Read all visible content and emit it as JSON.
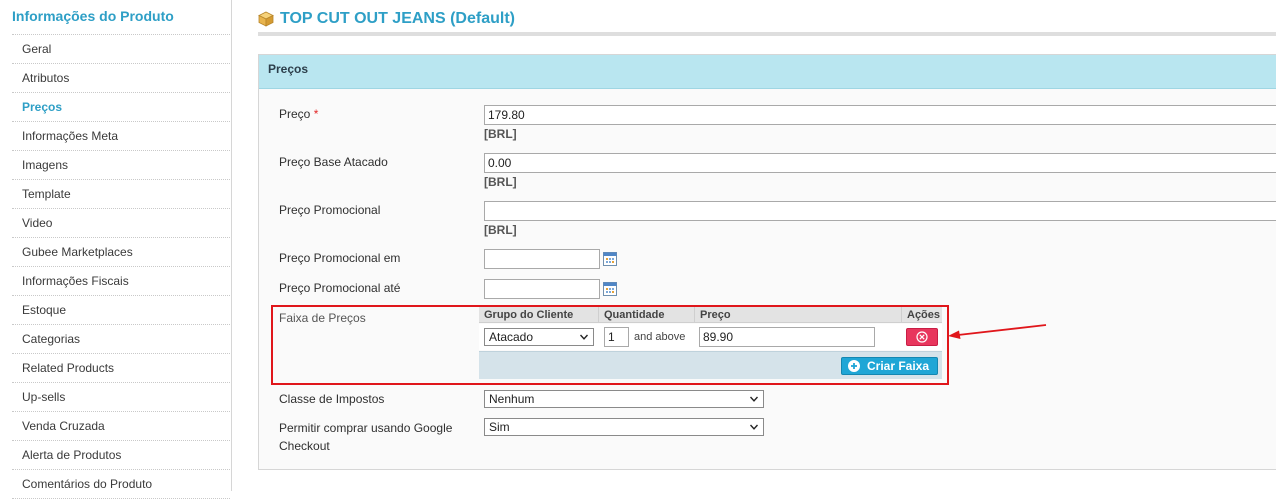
{
  "sidebar": {
    "title": "Informações do Produto",
    "items": [
      {
        "label": "Geral"
      },
      {
        "label": "Atributos"
      },
      {
        "label": "Preços",
        "active": true
      },
      {
        "label": "Informações Meta"
      },
      {
        "label": "Imagens"
      },
      {
        "label": "Template"
      },
      {
        "label": "Video"
      },
      {
        "label": "Gubee Marketplaces"
      },
      {
        "label": "Informações Fiscais"
      },
      {
        "label": "Estoque"
      },
      {
        "label": "Categorias"
      },
      {
        "label": "Related Products"
      },
      {
        "label": "Up-sells"
      },
      {
        "label": "Venda Cruzada"
      },
      {
        "label": "Alerta de Produtos"
      },
      {
        "label": "Comentários do Produto"
      }
    ]
  },
  "header": {
    "title": "TOP CUT OUT JEANS (Default)",
    "icon": "product-box-icon"
  },
  "section": {
    "title": "Preços",
    "fields": {
      "price": {
        "label": "Preço",
        "required_mark": "*",
        "value": "179.80",
        "currency": "[BRL]"
      },
      "wholesale_base_price": {
        "label": "Preço Base Atacado",
        "value": "0.00",
        "currency": "[BRL]"
      },
      "special_price": {
        "label": "Preço Promocional",
        "value": "",
        "currency": "[BRL]"
      },
      "special_from": {
        "label": "Preço Promocional em",
        "value": ""
      },
      "special_to": {
        "label": "Preço Promocional até",
        "value": ""
      },
      "tier_price": {
        "label": "Faixa de Preços",
        "columns": {
          "group": "Grupo do Cliente",
          "qty": "Quantidade",
          "price": "Preço",
          "actions": "Ações"
        },
        "rows": [
          {
            "group": "Atacado",
            "qty": "1",
            "qty_suffix": "and above",
            "price": "89.90"
          }
        ],
        "add_button": "Criar Faixa"
      },
      "tax_class": {
        "label": "Classe de Impostos",
        "value": "Nenhum"
      },
      "google_checkout": {
        "label": "Permitir comprar usando Google Checkout",
        "value": "Sim"
      }
    }
  },
  "colors": {
    "accent": "#2e9fc6",
    "section_header_bg": "#b9e6f0",
    "delete_button": "#e8365d",
    "add_button": "#1fa6d6",
    "annotation": "#e0161b"
  }
}
